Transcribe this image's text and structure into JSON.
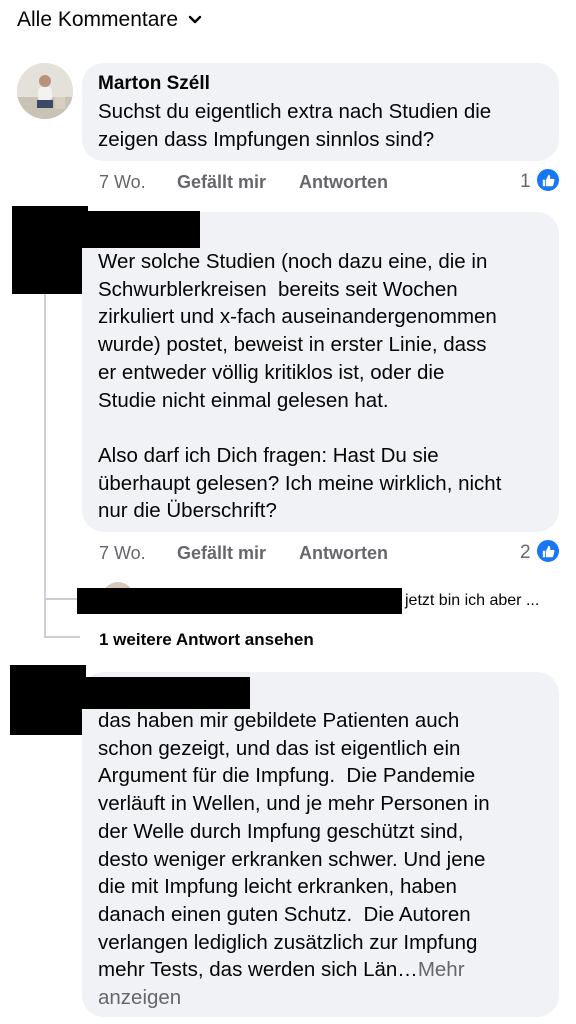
{
  "header": {
    "title": "Alle Kommentare",
    "chevron_icon": "chevron-down-icon"
  },
  "comments": [
    {
      "author": "Marton Széll",
      "text": "Suchst du eigentlich extra nach Studien die zeigen dass Impfungen sinnlos sind?",
      "time": "7 Wo.",
      "like_label": "Gefällt mir",
      "reply_label": "Antworten",
      "like_count": "1"
    },
    {
      "author": "",
      "text": "Wer solche Studien (noch dazu eine, die in\nSchwurblerkreisen  bereits seit Wochen\nzirkuliert und x-fach auseinandergenommen\nwurde) postet, beweist in erster Linie, dass\ner entweder völlig kritiklos ist, oder die\nStudie nicht einmal gelesen hat.\n\nAlso darf ich Dich fragen: Hast Du sie\nüberhaupt gelesen? Ich meine wirklich, nicht\nnur die Überschrift?",
      "time": "7 Wo.",
      "like_label": "Gefällt mir",
      "reply_label": "Antworten",
      "like_count": "2",
      "reply_preview": "jetzt bin ich aber ...",
      "more_replies": "1 weitere Antwort ansehen"
    },
    {
      "author": "",
      "text": "das haben mir gebildete Patienten auch\nschon gezeigt, und das ist eigentlich ein\nArgument für die Impfung.  Die Pandemie\nverläuft in Wellen, und je mehr Personen in\nder Welle durch Impfung geschützt sind,\ndesto weniger erkranken schwer. Und jene\ndie mit Impfung leicht erkranken, haben\ndanach einen guten Schutz.  Die Autoren\nverlangen lediglich zusätzlich zur Impfung\nmehr Tests, das werden sich Län…",
      "see_more": "Mehr\nanzeigen"
    }
  ],
  "colors": {
    "bubble": "#f0f2f5",
    "meta": "#65676b",
    "like_blue": "#1877f2"
  }
}
